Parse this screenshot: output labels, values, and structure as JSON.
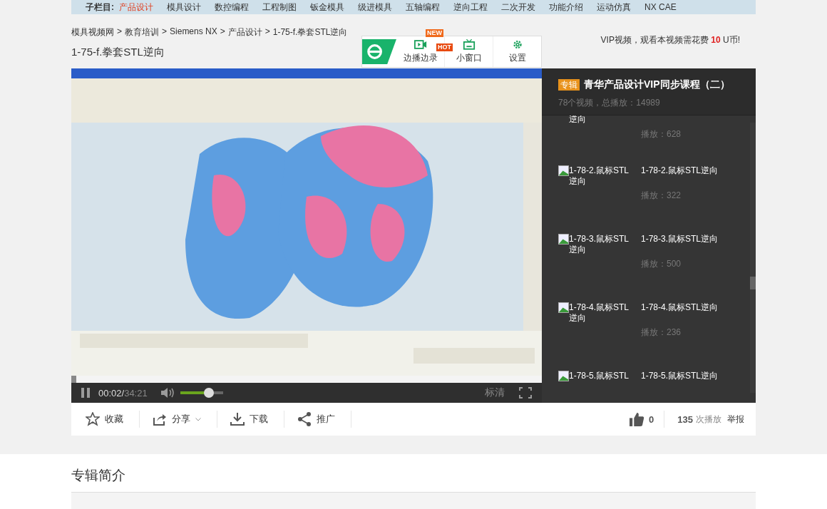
{
  "nav": {
    "label": "子栏目:",
    "items": [
      {
        "label": "产品设计",
        "selected": true
      },
      {
        "label": "模具设计",
        "selected": false
      },
      {
        "label": "数控编程",
        "selected": false
      },
      {
        "label": "工程制图",
        "selected": false
      },
      {
        "label": "钣金模具",
        "selected": false
      },
      {
        "label": "级进模具",
        "selected": false
      },
      {
        "label": "五轴编程",
        "selected": false
      },
      {
        "label": "逆向工程",
        "selected": false
      },
      {
        "label": "二次开发",
        "selected": false
      },
      {
        "label": "功能介绍",
        "selected": false
      },
      {
        "label": "运动仿真",
        "selected": false
      },
      {
        "label": "NX CAE",
        "selected": false
      }
    ]
  },
  "breadcrumb": {
    "separator": ">",
    "items": [
      "模具视频网",
      "教育培训",
      "Siemens NX",
      "产品设计",
      "1-75-f.拳套STL逆向"
    ]
  },
  "page_title": "1-75-f.拳套STL逆向",
  "player_toolbar": {
    "buttons": [
      {
        "kind": "record",
        "label": "边播边录",
        "badge_top": "NEW",
        "badge_side": "HOT"
      },
      {
        "kind": "mini",
        "label": "小窗口"
      },
      {
        "kind": "settings",
        "label": "设置"
      }
    ]
  },
  "vip_notice": "VIP视频，观看本视频需花费 **10** U币!",
  "video": {
    "progress": {
      "level": 0.01
    },
    "elapsed": "00:02/",
    "duration": "34:21",
    "volume": {
      "level": 0.67
    },
    "quality": "标清"
  },
  "playlist": {
    "tag": "专辑",
    "title": "青华产品设计VIP同步课程（二）",
    "summary": "78个视频，总播放：14989",
    "items": [
      {
        "thumb_alt": "逆向",
        "plays": "播放：628"
      },
      {
        "thumb_alt": "1-78-2.鼠标STL逆向",
        "title": "1-78-2.鼠标STL逆向",
        "plays": "播放：322"
      },
      {
        "thumb_alt": "1-78-3.鼠标STL逆向",
        "title": "1-78-3.鼠标STL逆向",
        "plays": "播放：500"
      },
      {
        "thumb_alt": "1-78-4.鼠标STL逆向",
        "title": "1-78-4.鼠标STL逆向",
        "plays": "播放：236"
      },
      {
        "thumb_alt": "1-78-5.鼠标STL",
        "title": "1-78-5.鼠标STL逆向"
      }
    ]
  },
  "actions": [
    {
      "kind": "favorite",
      "label": "收藏"
    },
    {
      "kind": "share",
      "label": "分享"
    },
    {
      "kind": "download",
      "label": "下载"
    },
    {
      "kind": "promote",
      "label": "推广"
    }
  ],
  "likes": "0",
  "play_count": "135",
  "play_count_unit": "次播放",
  "report": "举报",
  "album_intro": {
    "heading": "专辑简介"
  }
}
